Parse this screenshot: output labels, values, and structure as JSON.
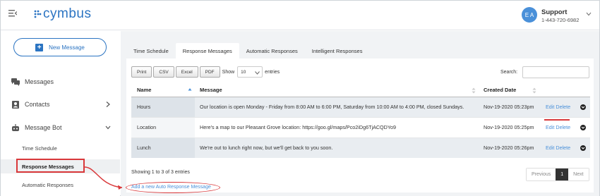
{
  "header": {
    "logo_text": "cymbus",
    "user": {
      "initials": "E A",
      "name": "Support",
      "phone": "1-443-720-6982"
    }
  },
  "sidebar": {
    "new_message_label": "New Message",
    "items": [
      {
        "label": "Messages",
        "icon": "chat-icon"
      },
      {
        "label": "Contacts",
        "icon": "contacts-icon"
      },
      {
        "label": "Message Bot",
        "icon": "bot-icon"
      }
    ],
    "sub_items": [
      {
        "label": "Time Schedule"
      },
      {
        "label": "Response Messages",
        "selected": true
      },
      {
        "label": "Automatic Responses"
      }
    ]
  },
  "tabs": [
    {
      "label": "Time Schedule"
    },
    {
      "label": "Response Messages",
      "active": true
    },
    {
      "label": "Automatic Responses"
    },
    {
      "label": "Intelligent Responses"
    }
  ],
  "toolbar": {
    "buttons": [
      "Print",
      "CSV",
      "Excel",
      "PDF"
    ],
    "show_label": "Show",
    "page_length": "10",
    "entries_label": "entries",
    "search_label": "Search:"
  },
  "table": {
    "columns": [
      "Name",
      "Message",
      "Created Date",
      ""
    ],
    "rows": [
      {
        "name": "Hours",
        "message": "Our location is open Monday - Friday from 8:00 AM to 6:00 PM, Saturday from 10:00 AM to 4:00 PM, closed Sundays.",
        "date": "Nov-19-2020 05:23pm",
        "edit": "Edit",
        "delete": "Delete"
      },
      {
        "name": "Location",
        "message": "Here's a map to our Pleasant Grove location: https://goo.gl/maps/Pco2iDg6TjACQDYo9",
        "date": "Nov-19-2020 05:25pm",
        "edit": "Edit",
        "delete": "Delete"
      },
      {
        "name": "Lunch",
        "message": "We're out to lunch right now, but we'll get back to you soon.",
        "date": "Nov-19-2020 05:26pm",
        "edit": "Edit",
        "delete": "Delete"
      }
    ]
  },
  "footer": {
    "showing": "Showing 1 to 3 of 3 entries",
    "previous": "Previous",
    "current_page": "1",
    "next": "Next",
    "add_link": "Add a new Auto Response Message"
  },
  "colors": {
    "accent": "#2b74c2",
    "link": "#4a90d9",
    "annotation": "#d9383a"
  }
}
